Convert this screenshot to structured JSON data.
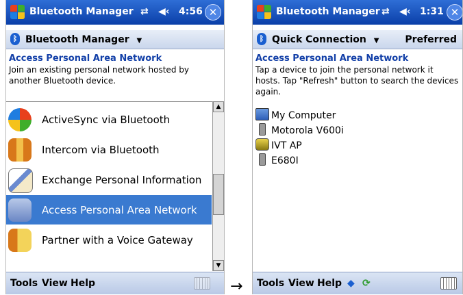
{
  "left": {
    "title": "Bluetooth Manager",
    "status": {
      "time": "4:56"
    },
    "menu": {
      "label": "Bluetooth Manager"
    },
    "header": {
      "title": "Access Personal Area Network",
      "description": "Join an existing personal network hosted by another Bluetooth device."
    },
    "services": [
      {
        "label": "ActiveSync via Bluetooth",
        "icon": "activesync-icon"
      },
      {
        "label": "Intercom via Bluetooth",
        "icon": "intercom-icon"
      },
      {
        "label": "Exchange Personal Information",
        "icon": "exchange-icon"
      },
      {
        "label": "Access Personal Area Network",
        "icon": "network-icon",
        "selected": true
      },
      {
        "label": "Partner with a Voice Gateway",
        "icon": "voice-gateway-icon"
      }
    ],
    "bottom": {
      "tools": "Tools",
      "view": "View",
      "help": "Help"
    }
  },
  "right": {
    "title": "Bluetooth Manager",
    "status": {
      "time": "1:31"
    },
    "menu": {
      "quick": "Quick Connection",
      "preferred": "Preferred"
    },
    "header": {
      "title": "Access Personal Area Network",
      "description": "Tap a device to join the personal network it hosts. Tap \"Refresh\" button to search the devices again."
    },
    "devices": [
      {
        "label": "My Computer",
        "icon": "computer-icon"
      },
      {
        "label": "Motorola V600i",
        "icon": "phone-icon"
      },
      {
        "label": "IVT AP",
        "icon": "access-point-icon"
      },
      {
        "label": "E680I",
        "icon": "phone-icon"
      }
    ],
    "bottom": {
      "tools": "Tools",
      "view": "View",
      "help": "Help"
    }
  },
  "arrow": "→",
  "colors": {
    "titlebar": "#0a3fa8",
    "selection": "#3a7ad0",
    "header_title": "#1340a8"
  }
}
